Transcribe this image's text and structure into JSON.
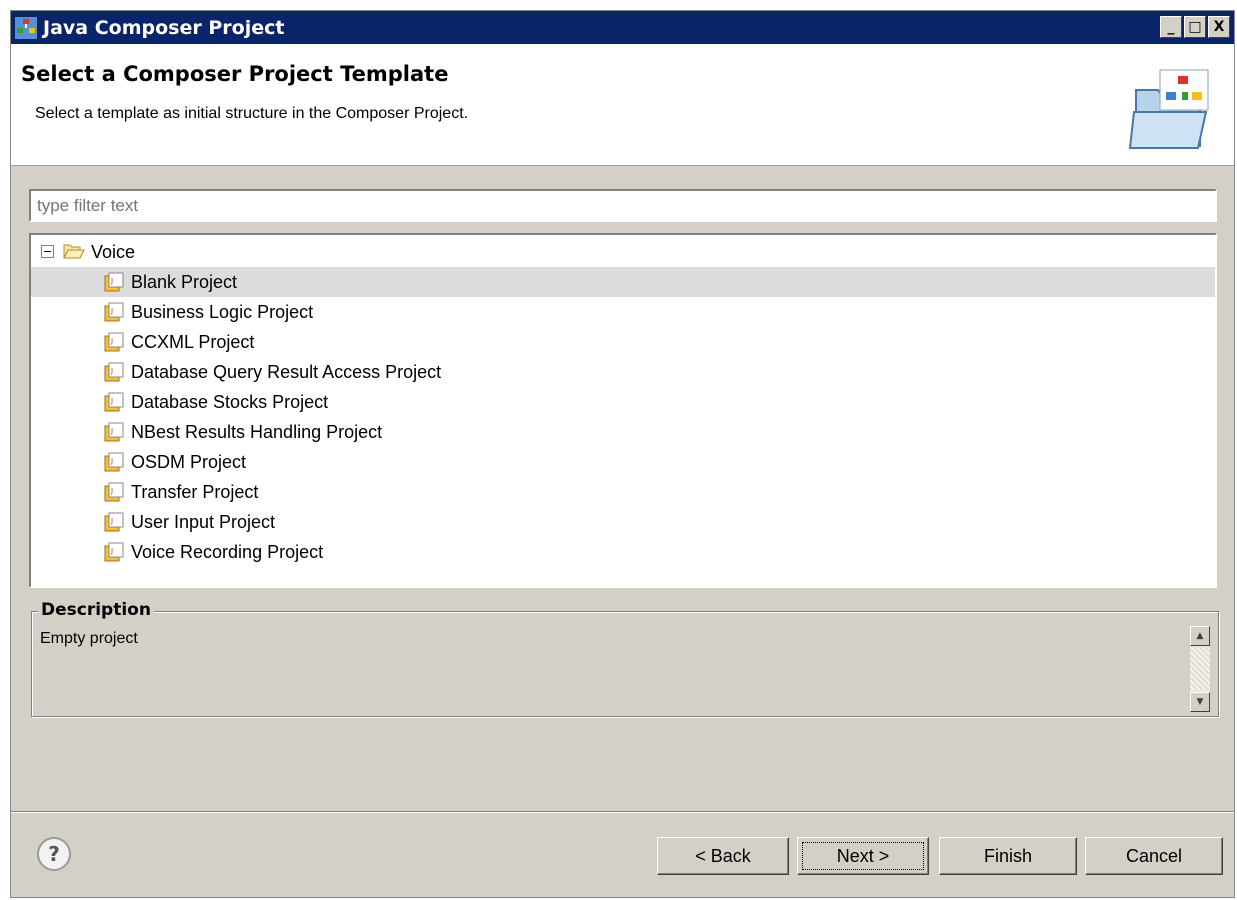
{
  "window": {
    "title": "Java Composer Project",
    "controls": {
      "minimize": "_",
      "maximize": "□",
      "close": "X"
    }
  },
  "header": {
    "title": "Select a Composer Project Template",
    "description": "Select a template as initial structure in the Composer Project."
  },
  "filter": {
    "placeholder": "type filter text",
    "value": ""
  },
  "tree": {
    "root": {
      "label": "Voice",
      "expanded": true,
      "icon": "folder-open-icon"
    },
    "items": [
      {
        "label": "Blank Project",
        "selected": true
      },
      {
        "label": "Business Logic Project"
      },
      {
        "label": "CCXML Project"
      },
      {
        "label": "Database Query Result Access Project"
      },
      {
        "label": "Database Stocks Project"
      },
      {
        "label": "NBest Results Handling Project"
      },
      {
        "label": "OSDM Project"
      },
      {
        "label": "Transfer Project"
      },
      {
        "label": "User Input Project"
      },
      {
        "label": "Voice Recording Project"
      }
    ]
  },
  "description_group": {
    "legend": "Description",
    "text": "Empty project"
  },
  "buttons": {
    "help": "?",
    "back": "< Back",
    "next": "Next >",
    "finish": "Finish",
    "cancel": "Cancel"
  },
  "colors": {
    "titlebar": "#0a246a",
    "dialog_bg": "#d4d0c8",
    "selection": "#dcdcdc"
  }
}
